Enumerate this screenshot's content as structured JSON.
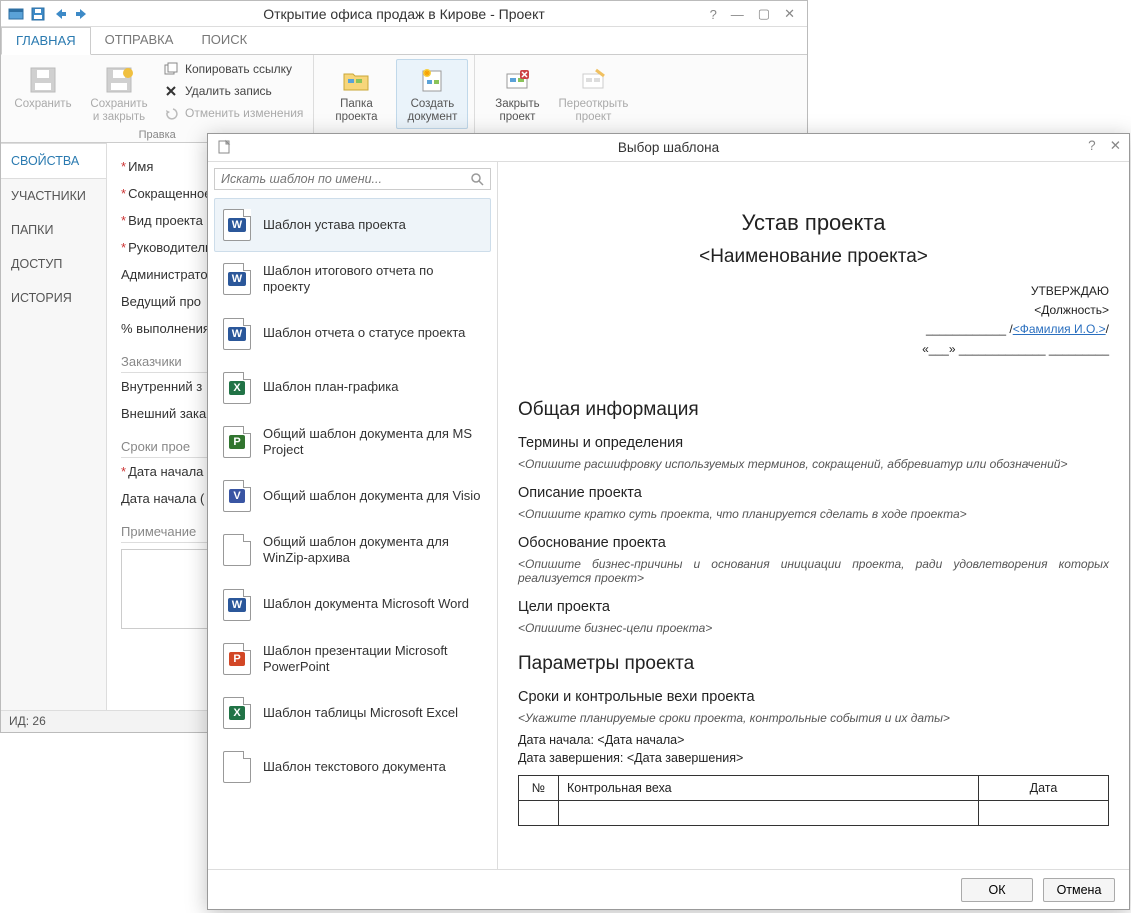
{
  "window": {
    "title": "Открытие офиса продаж в Кирове - Проект",
    "status": "ИД: 26"
  },
  "ribbon": {
    "tabs": [
      "ГЛАВНАЯ",
      "ОТПРАВКА",
      "ПОИСК"
    ],
    "save": "Сохранить",
    "save_close": "Сохранить\nи закрыть",
    "copy_link": "Копировать ссылку",
    "delete": "Удалить запись",
    "undo": "Отменить изменения",
    "group_edit": "Правка",
    "project_folder": "Папка\nпроекта",
    "create_doc": "Создать\nдокумент",
    "close_proj": "Закрыть\nпроект",
    "reopen_proj": "Переоткрыть\nпроект"
  },
  "sidebar": {
    "items": [
      "СВОЙСТВА",
      "УЧАСТНИКИ",
      "ПАПКИ",
      "ДОСТУП",
      "ИСТОРИЯ"
    ]
  },
  "form": {
    "name": "Имя",
    "short": "Сокращенное",
    "kind": "Вид проекта",
    "manager": "Руководитель",
    "admin": "Администратор",
    "lead": "Ведущий про",
    "progress": "% выполнения",
    "customers_hdr": "Заказчики",
    "internal": "Внутренний з",
    "external": "Внешний зака",
    "dates_hdr": "Сроки прое",
    "start_plan": "Дата начала (",
    "start_fact": "Дата начала (",
    "note": "Примечание"
  },
  "dialog": {
    "title": "Выбор шаблона",
    "search_ph": "Искать шаблон по имени...",
    "ok": "ОК",
    "cancel": "Отмена"
  },
  "templates": [
    {
      "label": "Шаблон устава проекта",
      "badge": "W",
      "color": "#2b579a"
    },
    {
      "label": "Шаблон итогового отчета по проекту",
      "badge": "W",
      "color": "#2b579a"
    },
    {
      "label": "Шаблон отчета о статусе проекта",
      "badge": "W",
      "color": "#2b579a"
    },
    {
      "label": "Шаблон план-графика",
      "badge": "X",
      "color": "#217346"
    },
    {
      "label": "Общий шаблон документа для MS Project",
      "badge": "P",
      "color": "#31752f"
    },
    {
      "label": "Общий шаблон документа для Visio",
      "badge": "V",
      "color": "#3955a3"
    },
    {
      "label": "Общий шаблон документа для WinZip-архива",
      "badge": "",
      "color": "#999"
    },
    {
      "label": "Шаблон документа Microsoft Word",
      "badge": "W",
      "color": "#2b579a"
    },
    {
      "label": "Шаблон презентации Microsoft PowerPoint",
      "badge": "P",
      "color": "#d24726"
    },
    {
      "label": "Шаблон таблицы Microsoft Excel",
      "badge": "X",
      "color": "#217346"
    },
    {
      "label": "Шаблон текстового документа",
      "badge": "",
      "color": "#999"
    }
  ],
  "preview": {
    "h1": "Устав проекта",
    "sub": "<Наименование проекта>",
    "approve": "УТВЕРЖДАЮ",
    "position": "<Должность>",
    "fio": "<Фамилия И.О.>",
    "date_line": "«___» _____________ _________",
    "sec1": "Общая информация",
    "terms_h": "Термины и определения",
    "terms_ph": "<Опишите расшифровку используемых терминов, сокращений, аббревиатур или обозначений>",
    "desc_h": "Описание проекта",
    "desc_ph": "<Опишите кратко суть проекта, что планируется сделать в ходе проекта>",
    "just_h": "Обоснование проекта",
    "just_ph": "<Опишите бизнес-причины и основания инициации проекта, ради удовлетворения которых реализуется проект>",
    "goals_h": "Цели проекта",
    "goals_ph": "<Опишите бизнес-цели проекта>",
    "sec2": "Параметры проекта",
    "milestones_h": "Сроки и контрольные вехи проекта",
    "milestones_ph": "<Укажите планируемые сроки проекта, контрольные события и их даты>",
    "start": "Дата начала: <Дата начала>",
    "end": "Дата завершения: <Дата завершения>",
    "tbl_num": "№",
    "tbl_milestone": "Контрольная веха",
    "tbl_date": "Дата"
  }
}
